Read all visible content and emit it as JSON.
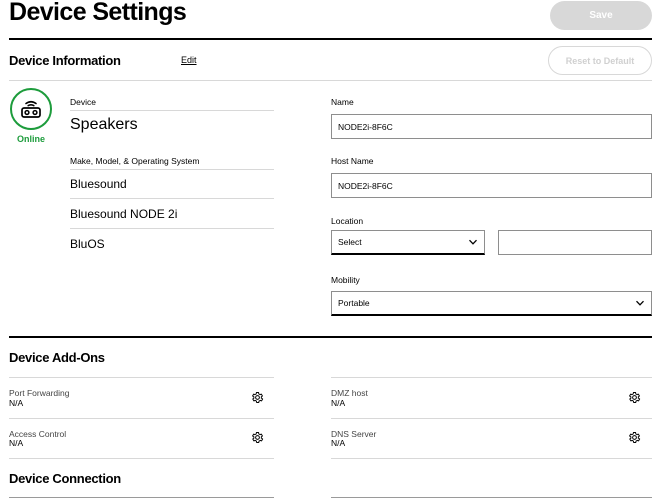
{
  "header": {
    "title": "Device Settings",
    "save_label": "Save"
  },
  "device_info": {
    "title": "Device Information",
    "edit_label": "Edit",
    "reset_label": "Reset to Default",
    "status": "Online",
    "device_label": "Device",
    "device_value": "Speakers",
    "make_label": "Make, Model, & Operating System",
    "make": "Bluesound",
    "model": "Bluesound NODE 2i",
    "os": "BluOS"
  },
  "form": {
    "name_label": "Name",
    "name_value": "NODE2i-8F6C",
    "host_label": "Host Name",
    "host_value": "NODE2i-8F6C",
    "location_label": "Location",
    "location_value": "Select",
    "location_extra": "",
    "mobility_label": "Mobility",
    "mobility_value": "Portable"
  },
  "addons": {
    "title": "Device Add-Ons",
    "items": [
      {
        "label": "Port Forwarding",
        "value": "N/A"
      },
      {
        "label": "DMZ host",
        "value": "N/A"
      },
      {
        "label": "Access Control",
        "value": "N/A"
      },
      {
        "label": "DNS Server",
        "value": "N/A"
      }
    ]
  },
  "connection": {
    "title": "Device Connection"
  },
  "icons": {
    "device": "speaker-icon",
    "settings": "gear-icon",
    "dropdown": "chevron-down-icon"
  },
  "colors": {
    "online": "#1d9c3c",
    "disabled": "#d8d8d8"
  }
}
